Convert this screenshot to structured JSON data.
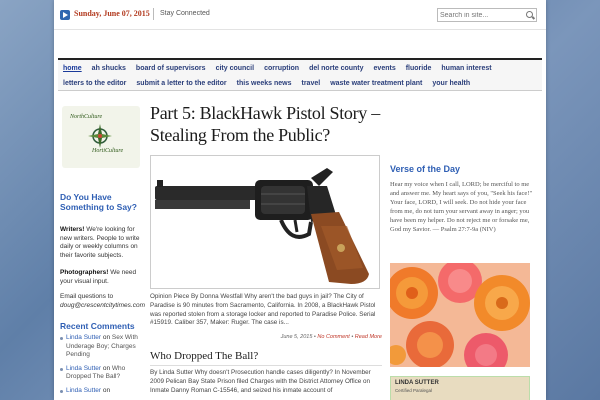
{
  "topbar": {
    "date": "Sunday, June 07, 2015",
    "stay_connected": "Stay Connected",
    "search_placeholder": "Search in site..."
  },
  "nav": {
    "row1": [
      "home",
      "ah shucks",
      "board of supervisors",
      "city council",
      "corruption",
      "del norte county",
      "events",
      "fluoride",
      "human interest"
    ],
    "row2": [
      "letters to the editor",
      "submit a letter to the editor",
      "this weeks news",
      "travel",
      "waste water treatment plant",
      "your health"
    ],
    "active": "home"
  },
  "sidebar": {
    "logo_top": "NorthCulture",
    "logo_bottom": "HortiCulture",
    "heading": "Do You Have Something to Say?",
    "writers_label": "Writers!",
    "writers_text": " We're looking for new writers. People to write daily or weekly columns on their favorite subjects.",
    "photographers_label": "Photographers!",
    "photographers_text": " We need your visual input.",
    "email_text": "Email questions to ",
    "email": "doug@crescentcitytimes.com",
    "recent_heading": "Recent Comments",
    "recent": [
      {
        "author": "Linda Sutter",
        "on": " on ",
        "title": "Sex With Underage Boy; Charges Pending"
      },
      {
        "author": "Linda Sutter",
        "on": " on ",
        "title": "Who Dropped The Ball?"
      },
      {
        "author": "Linda Sutter",
        "on": " on ",
        "title": ""
      }
    ]
  },
  "main": {
    "title": "Part 5: BlackHawk Pistol Story – Stealing From the Public?",
    "excerpt": "Opinion Piece By Donna Westfall Why aren't the bad guys in jail? The City of Paradise is 90 minutes from Sacramento, California.  In 2008, a BlackHawk Pistol was reported stolen from a storage locker and reported to Paradise Police.  Serial #15919.  Caliber 357, Maker: Ruger. The case is...",
    "date": "June 5, 2015",
    "comments": "No Comment",
    "read_more": "Read More",
    "post2_title": "Who Dropped The Ball?",
    "post2_excerpt": "By Linda Sutter Why doesn't Prosecution handle cases diligently? In November 2009 Pelican Bay State Prison filed Charges with the District Attorney Office on Inmate Danny Roman C-15546, and seized his inmate account of"
  },
  "right": {
    "verse_heading": "Verse of the Day",
    "verse_text": "Hear my voice when I call, LORD; be merciful to me and answer me. My heart says of you, \"Seek his face!\" Your face, LORD, I will seek. Do not hide your face from me, do not turn your servant away in anger; you have been my helper. Do not reject me or forsake me, God my Savior. — Psalm 27:7-9a (NIV)",
    "ad_name": "LINDA SUTTER",
    "ad_sub": "Certified Paralegal"
  },
  "colors": {
    "accent_blue": "#2f5fb4",
    "date_red": "#b23a1f",
    "nav_blue": "#2a3e7a"
  }
}
